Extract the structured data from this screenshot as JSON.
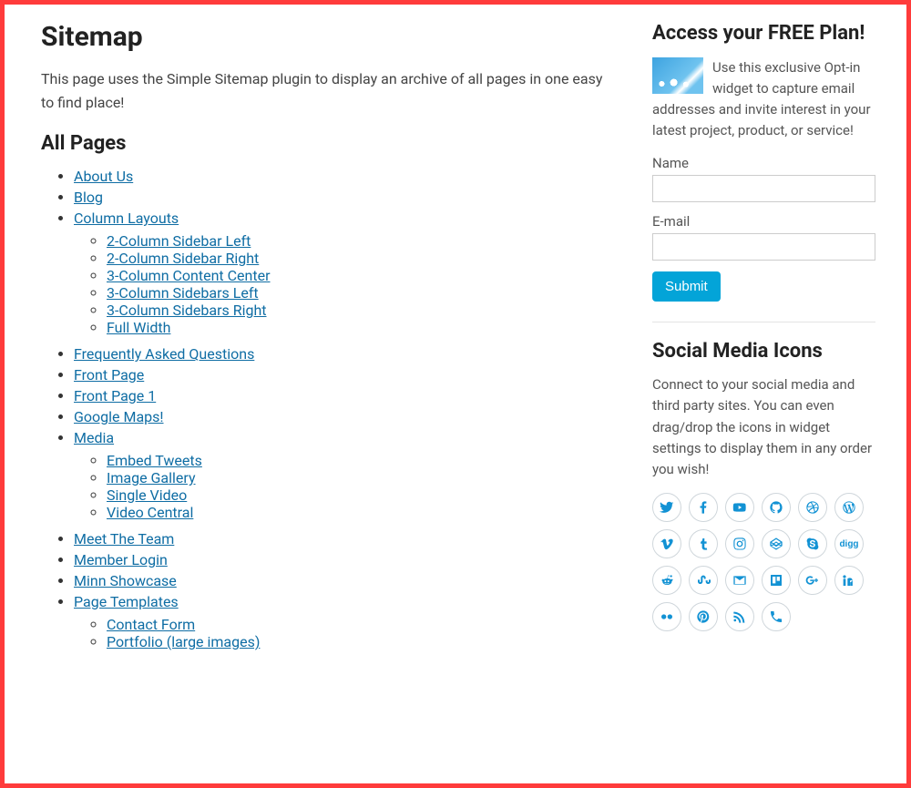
{
  "main": {
    "title": "Sitemap",
    "intro": "This page uses the Simple Sitemap plugin to display an archive of all pages in one easy to find place!",
    "section_title": "All Pages",
    "items": [
      {
        "label": "About Us"
      },
      {
        "label": "Blog"
      },
      {
        "label": "Column Layouts",
        "children": [
          {
            "label": "2-Column Sidebar Left"
          },
          {
            "label": "2-Column Sidebar Right"
          },
          {
            "label": "3-Column Content Center"
          },
          {
            "label": "3-Column Sidebars Left"
          },
          {
            "label": "3-Column Sidebars Right"
          },
          {
            "label": "Full Width"
          }
        ]
      },
      {
        "label": "Frequently Asked Questions"
      },
      {
        "label": "Front Page"
      },
      {
        "label": "Front Page 1"
      },
      {
        "label": "Google Maps!"
      },
      {
        "label": "Media",
        "children": [
          {
            "label": "Embed Tweets"
          },
          {
            "label": "Image Gallery"
          },
          {
            "label": "Single Video"
          },
          {
            "label": "Video Central"
          }
        ]
      },
      {
        "label": "Meet The Team"
      },
      {
        "label": "Member Login"
      },
      {
        "label": "Minn Showcase"
      },
      {
        "label": "Page Templates",
        "children": [
          {
            "label": "Contact Form"
          },
          {
            "label": "Portfolio (large images)"
          }
        ]
      }
    ]
  },
  "sidebar": {
    "optin": {
      "title": "Access your FREE Plan!",
      "desc": "Use this exclusive Opt-in widget to capture email addresses and invite interest in your latest project, product, or service!",
      "name_label": "Name",
      "email_label": "E-mail",
      "submit_label": "Submit"
    },
    "social": {
      "title": "Social Media Icons",
      "desc": "Connect to your social media and third party sites. You can even drag/drop the icons in widget settings to display them in any order you wish!",
      "icons": [
        "twitter",
        "facebook",
        "youtube",
        "github",
        "dribbble",
        "wordpress",
        "vimeo",
        "tumblr",
        "instagram",
        "codepen",
        "skype",
        "digg",
        "reddit",
        "stumbleupon",
        "email",
        "trello",
        "googleplus",
        "linkedin",
        "flickr",
        "pinterest",
        "rss",
        "phone"
      ]
    }
  }
}
